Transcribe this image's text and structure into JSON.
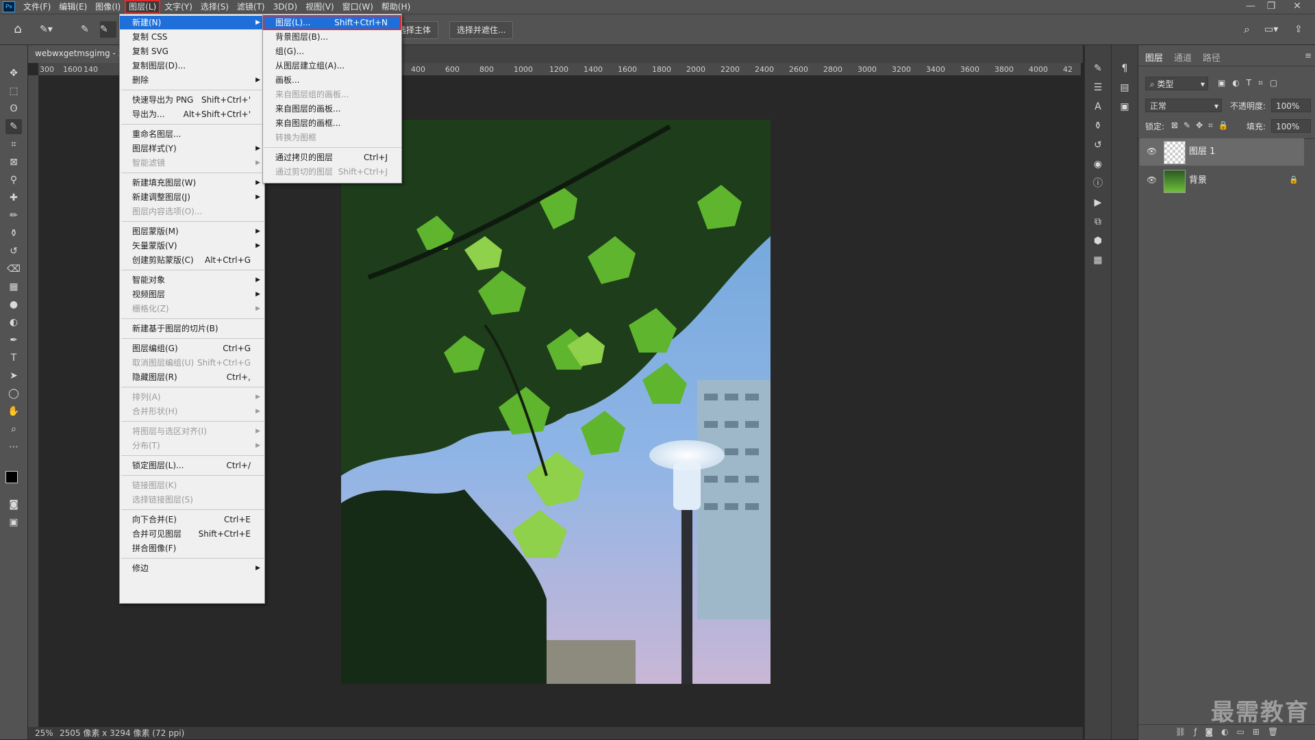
{
  "menubar": {
    "app_icon": "Ps",
    "items": [
      "文件(F)",
      "编辑(E)",
      "图像(I)",
      "图层(L)",
      "文字(Y)",
      "选择(S)",
      "滤镜(T)",
      "3D(D)",
      "视图(V)",
      "窗口(W)",
      "帮助(H)"
    ],
    "active_index": 3,
    "window_controls": [
      "—",
      "❐",
      "✕"
    ]
  },
  "options_bar": {
    "buttons": [
      "选择主体",
      "选择并遮住..."
    ]
  },
  "document": {
    "tab_title": "webwxgetmsgimg - 2",
    "ruler_labels": [
      "300",
      "1600",
      "140",
      "400",
      "600",
      "800",
      "1000",
      "1200",
      "1400",
      "1600",
      "1800",
      "2000",
      "2200",
      "2400",
      "2600",
      "2800",
      "3000",
      "3200",
      "3400",
      "3600",
      "3800",
      "4000",
      "42"
    ],
    "zoom": "25%",
    "size_info": "2505 像素 x 3294 像素 (72 ppi)"
  },
  "layer_menu": {
    "items": [
      {
        "label": "新建(N)",
        "shortcut": "",
        "submenu": true,
        "disabled": false,
        "highlight": true
      },
      {
        "label": "复制 CSS",
        "shortcut": "",
        "submenu": false,
        "disabled": false
      },
      {
        "label": "复制 SVG",
        "shortcut": "",
        "submenu": false,
        "disabled": false
      },
      {
        "label": "复制图层(D)...",
        "shortcut": "",
        "submenu": false,
        "disabled": false
      },
      {
        "label": "删除",
        "shortcut": "",
        "submenu": true,
        "disabled": false
      },
      {
        "sep": true
      },
      {
        "label": "快速导出为 PNG",
        "shortcut": "Shift+Ctrl+'",
        "submenu": false,
        "disabled": false
      },
      {
        "label": "导出为...",
        "shortcut": "Alt+Shift+Ctrl+'",
        "submenu": false,
        "disabled": false
      },
      {
        "sep": true
      },
      {
        "label": "重命名图层...",
        "shortcut": "",
        "submenu": false,
        "disabled": false
      },
      {
        "label": "图层样式(Y)",
        "shortcut": "",
        "submenu": true,
        "disabled": false
      },
      {
        "label": "智能滤镜",
        "shortcut": "",
        "submenu": true,
        "disabled": true
      },
      {
        "sep": true
      },
      {
        "label": "新建填充图层(W)",
        "shortcut": "",
        "submenu": true,
        "disabled": false
      },
      {
        "label": "新建调整图层(J)",
        "shortcut": "",
        "submenu": true,
        "disabled": false
      },
      {
        "label": "图层内容选项(O)...",
        "shortcut": "",
        "submenu": false,
        "disabled": true
      },
      {
        "sep": true
      },
      {
        "label": "图层蒙版(M)",
        "shortcut": "",
        "submenu": true,
        "disabled": false
      },
      {
        "label": "矢量蒙版(V)",
        "shortcut": "",
        "submenu": true,
        "disabled": false
      },
      {
        "label": "创建剪贴蒙版(C)",
        "shortcut": "Alt+Ctrl+G",
        "submenu": false,
        "disabled": false
      },
      {
        "sep": true
      },
      {
        "label": "智能对象",
        "shortcut": "",
        "submenu": true,
        "disabled": false
      },
      {
        "label": "视频图层",
        "shortcut": "",
        "submenu": true,
        "disabled": false
      },
      {
        "label": "栅格化(Z)",
        "shortcut": "",
        "submenu": true,
        "disabled": true
      },
      {
        "sep": true
      },
      {
        "label": "新建基于图层的切片(B)",
        "shortcut": "",
        "submenu": false,
        "disabled": false
      },
      {
        "sep": true
      },
      {
        "label": "图层编组(G)",
        "shortcut": "Ctrl+G",
        "submenu": false,
        "disabled": false
      },
      {
        "label": "取消图层编组(U)",
        "shortcut": "Shift+Ctrl+G",
        "submenu": false,
        "disabled": true
      },
      {
        "label": "隐藏图层(R)",
        "shortcut": "Ctrl+,",
        "submenu": false,
        "disabled": false
      },
      {
        "sep": true
      },
      {
        "label": "排列(A)",
        "shortcut": "",
        "submenu": true,
        "disabled": true
      },
      {
        "label": "合并形状(H)",
        "shortcut": "",
        "submenu": true,
        "disabled": true
      },
      {
        "sep": true
      },
      {
        "label": "将图层与选区对齐(I)",
        "shortcut": "",
        "submenu": true,
        "disabled": true
      },
      {
        "label": "分布(T)",
        "shortcut": "",
        "submenu": true,
        "disabled": true
      },
      {
        "sep": true
      },
      {
        "label": "锁定图层(L)...",
        "shortcut": "Ctrl+/",
        "submenu": false,
        "disabled": false
      },
      {
        "sep": true
      },
      {
        "label": "链接图层(K)",
        "shortcut": "",
        "submenu": false,
        "disabled": true
      },
      {
        "label": "选择链接图层(S)",
        "shortcut": "",
        "submenu": false,
        "disabled": true
      },
      {
        "sep": true
      },
      {
        "label": "向下合并(E)",
        "shortcut": "Ctrl+E",
        "submenu": false,
        "disabled": false
      },
      {
        "label": "合并可见图层",
        "shortcut": "Shift+Ctrl+E",
        "submenu": false,
        "disabled": false
      },
      {
        "label": "拼合图像(F)",
        "shortcut": "",
        "submenu": false,
        "disabled": false
      },
      {
        "sep": true
      },
      {
        "label": "修边",
        "shortcut": "",
        "submenu": true,
        "disabled": false
      }
    ]
  },
  "new_submenu": {
    "items": [
      {
        "label": "图层(L)...",
        "shortcut": "Shift+Ctrl+N",
        "disabled": false,
        "highlight": true
      },
      {
        "label": "背景图层(B)...",
        "shortcut": "",
        "disabled": false
      },
      {
        "label": "组(G)...",
        "shortcut": "",
        "disabled": false
      },
      {
        "label": "从图层建立组(A)...",
        "shortcut": "",
        "disabled": false
      },
      {
        "label": "画板...",
        "shortcut": "",
        "disabled": false
      },
      {
        "label": "来自图层组的画板...",
        "shortcut": "",
        "disabled": true
      },
      {
        "label": "来自图层的画板...",
        "shortcut": "",
        "disabled": false
      },
      {
        "label": "来自图层的画框...",
        "shortcut": "",
        "disabled": false
      },
      {
        "label": "转换为图框",
        "shortcut": "",
        "disabled": true
      },
      {
        "sep": true
      },
      {
        "label": "通过拷贝的图层",
        "shortcut": "Ctrl+J",
        "disabled": false
      },
      {
        "label": "通过剪切的图层",
        "shortcut": "Shift+Ctrl+J",
        "disabled": true
      }
    ]
  },
  "layers_panel": {
    "tabs": [
      "图层",
      "通道",
      "路径"
    ],
    "filter_label": "类型",
    "blend_mode": "正常",
    "opacity_label": "不透明度:",
    "opacity_value": "100%",
    "lock_label": "锁定:",
    "fill_label": "填充:",
    "fill_value": "100%",
    "layers": [
      {
        "name": "图层 1",
        "selected": true
      },
      {
        "name": "背景",
        "selected": false,
        "locked": true
      }
    ]
  },
  "watermark": "最需教育",
  "colors": {
    "menu_highlight": "#1e6fd9",
    "annotation_red": "#e02b2b"
  }
}
